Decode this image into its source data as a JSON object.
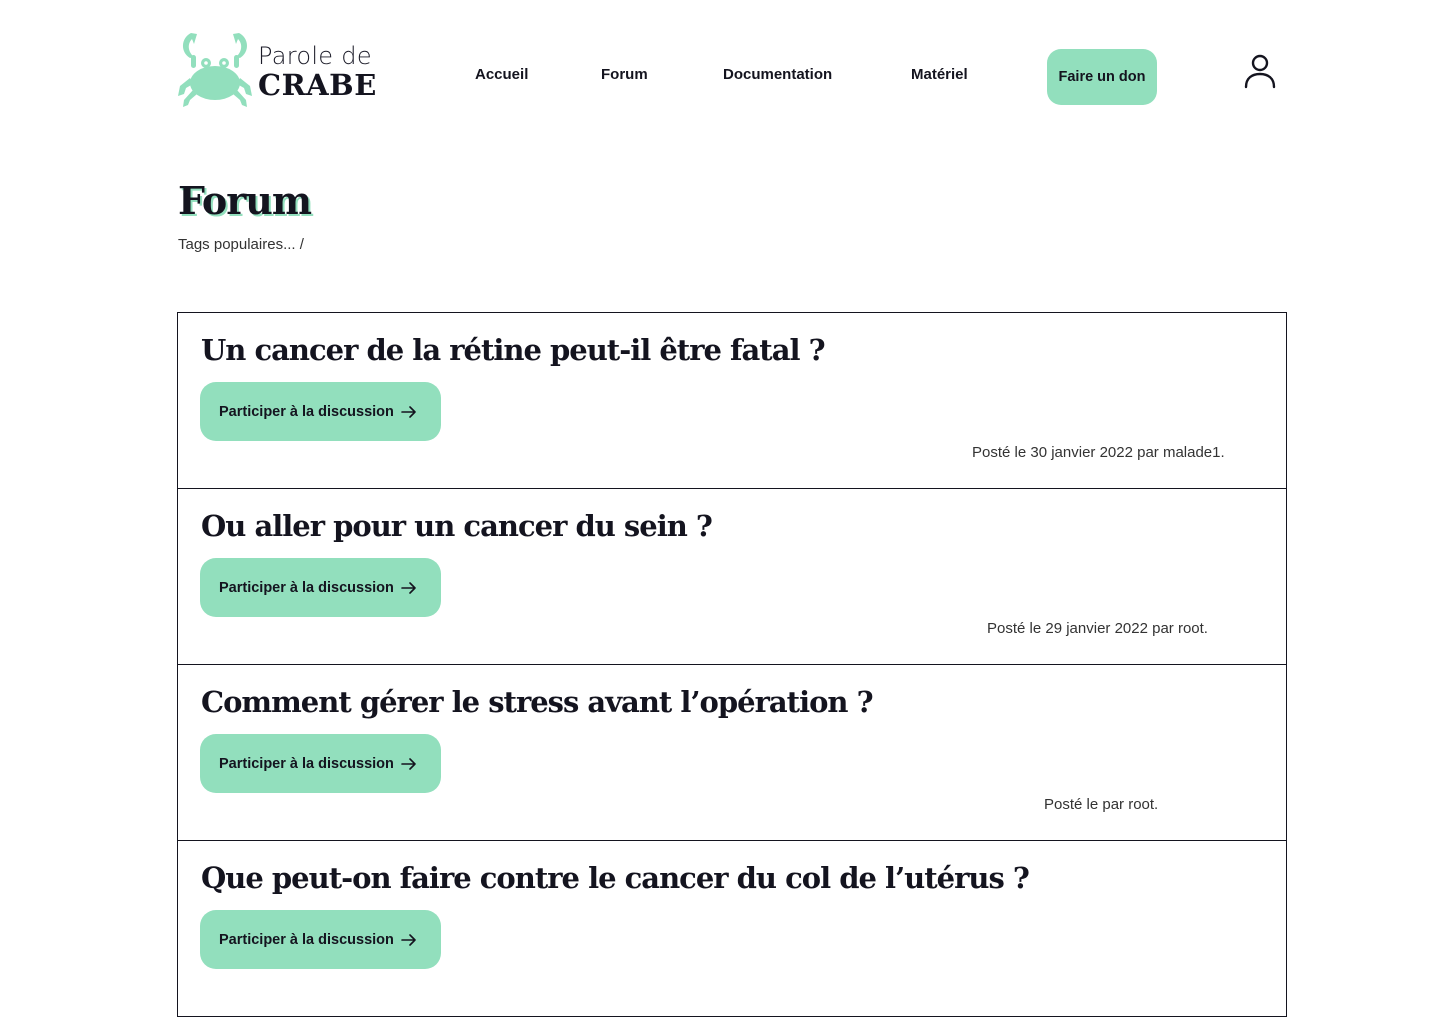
{
  "brand": {
    "line1": "Parole de",
    "line2": "CRABE",
    "accent": "#92dfbd",
    "text_color": "#14141f"
  },
  "nav": {
    "items": [
      {
        "label": "Accueil"
      },
      {
        "label": "Forum"
      },
      {
        "label": "Documentation"
      },
      {
        "label": "Matériel"
      }
    ],
    "donate_label": "Faire un don",
    "user_icon": "user-icon"
  },
  "page": {
    "title": "Forum",
    "tags": "Tags populaires... /"
  },
  "posts": [
    {
      "title": "Un cancer de la rétine peut-il être fatal ?",
      "button": "Participer à la discussion",
      "meta": "Posté le 30 janvier 2022 par malade1."
    },
    {
      "title": "Ou aller pour un cancer du sein ?",
      "button": "Participer à la discussion",
      "meta": "Posté le 29 janvier 2022 par root."
    },
    {
      "title": "Comment gérer le stress avant l’opération ?",
      "button": "Participer à la discussion",
      "meta": "Posté le  par root."
    },
    {
      "title": "Que peut-on faire contre le cancer du col de l’utérus ?",
      "button": "Participer à la discussion",
      "meta": ""
    }
  ]
}
